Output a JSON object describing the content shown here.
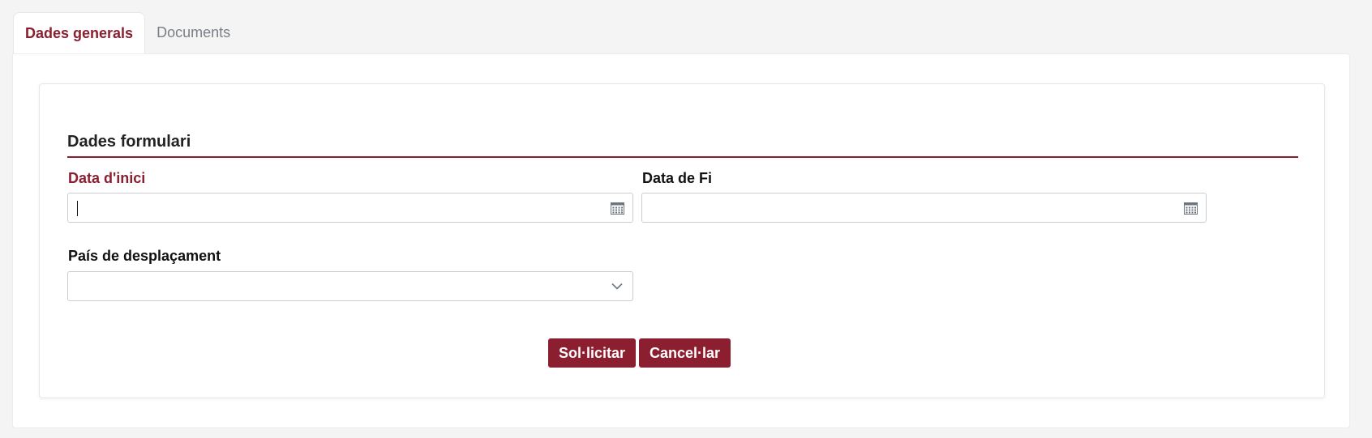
{
  "tabs": [
    {
      "label": "Dades generals",
      "active": true
    },
    {
      "label": "Documents",
      "active": false
    }
  ],
  "form": {
    "section_title": "Dades formulari",
    "start_date": {
      "label": "Data d'inici",
      "value": "",
      "required": true,
      "icon": "calendar-icon"
    },
    "end_date": {
      "label": "Data de Fi",
      "value": "",
      "icon": "calendar-icon"
    },
    "country": {
      "label": "País de desplaçament",
      "selected": "",
      "icon": "chevron-down-icon"
    }
  },
  "actions": {
    "submit_label": "Sol·licitar",
    "cancel_label": "Cancel·lar"
  },
  "colors": {
    "accent": "#8b1e2f",
    "page_background": "#f4f4f4",
    "inactive_tab_text": "#7a7f87",
    "input_border": "#c9cdd2"
  }
}
